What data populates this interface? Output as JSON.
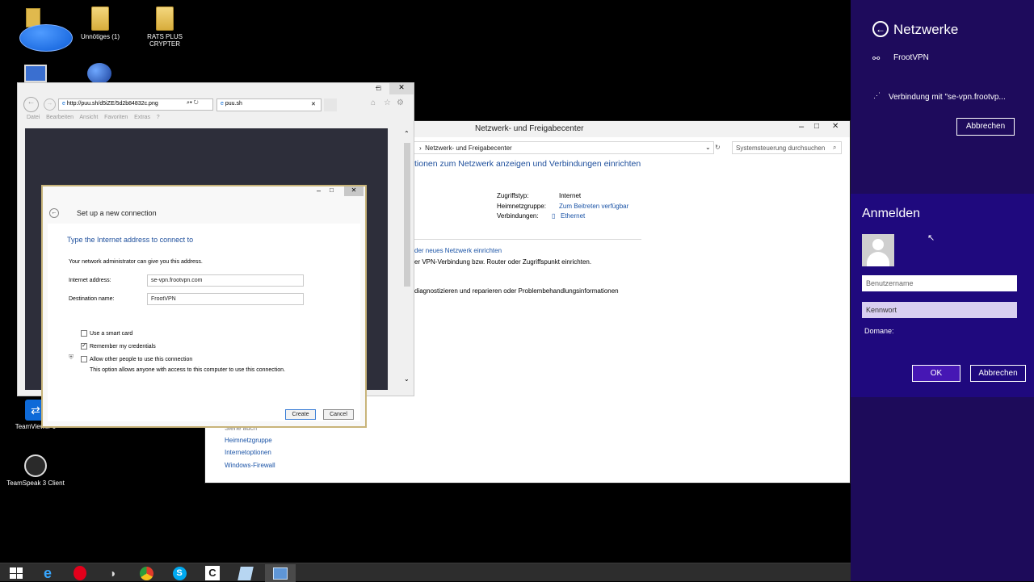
{
  "desktop": {
    "icons": [
      {
        "label": "",
        "icon": "blue-oval-icon"
      },
      {
        "label": "Unnötiges (1)",
        "icon": "folder-icon"
      },
      {
        "label": "RATS PLUS CRYPTER",
        "icon": "folder-icon"
      },
      {
        "label": "TeamViewer 9",
        "icon": "teamviewer-icon"
      },
      {
        "label": "TeamSpeak 3 Client",
        "icon": "teamspeak-icon"
      }
    ]
  },
  "ie": {
    "url": "http://puu.sh/d5iZE/5d2b84832c.png",
    "tab": "puu.sh",
    "menu": [
      "Datei",
      "Bearbeiten",
      "Ansicht",
      "Favoriten",
      "Extras",
      "?"
    ]
  },
  "dialog": {
    "title": "Set up a new connection",
    "heading": "Type the Internet address to connect to",
    "intro": "Your network administrator can give you this address.",
    "address_label": "Internet address:",
    "address_value": "se-vpn.frootvpn.com",
    "dest_label": "Destination name:",
    "dest_value": "FrootVPN",
    "smartcard": "Use a smart card",
    "remember": "Remember my credentials",
    "allow": "Allow other people to use this connection",
    "allow_note": "This option allows anyone with access to this computer to use this connection.",
    "create": "Create",
    "cancel": "Cancel"
  },
  "control_panel": {
    "title": "Netzwerk- und Freigabecenter",
    "breadcrumb": "Netzwerk- und Freigabecenter",
    "search_placeholder": "Systemsteuerung durchsuchen",
    "heading": "tionen zum Netzwerk anzeigen und Verbindungen einrichten",
    "access_type_label": "Zugriffstyp:",
    "access_type_value": "Internet",
    "homegroup_label": "Heimnetzgruppe:",
    "homegroup_value": "Zum Beitreten verfügbar",
    "connections_label": "Verbindungen:",
    "connections_value": "Ethernet",
    "link_new": "der neues Netzwerk einrichten",
    "text_vpn": "er VPN-Verbindung bzw. Router oder Zugriffspunkt einrichten.",
    "text_diag": "diagnostizieren und reparieren oder Problembehandlungsinformationen",
    "see_also": "Siehe auch",
    "see_links": [
      "Heimnetzgruppe",
      "Internetoptionen",
      "Windows-Firewall"
    ]
  },
  "charm": {
    "networks_title": "Netzwerke",
    "vpn_name": "FrootVPN",
    "connecting": "Verbindung mit \"se-vpn.frootvp...",
    "abort_top": "Abbrechen",
    "login_title": "Anmelden",
    "username_placeholder": "Benutzername",
    "password_placeholder": "Kennwort",
    "domain_label": "Domane:",
    "ok": "OK",
    "abort": "Abbrechen"
  },
  "colors": {
    "charm_bg": "#1d0b5a",
    "login_bg": "#1f097e",
    "link": "#1a53a6"
  }
}
